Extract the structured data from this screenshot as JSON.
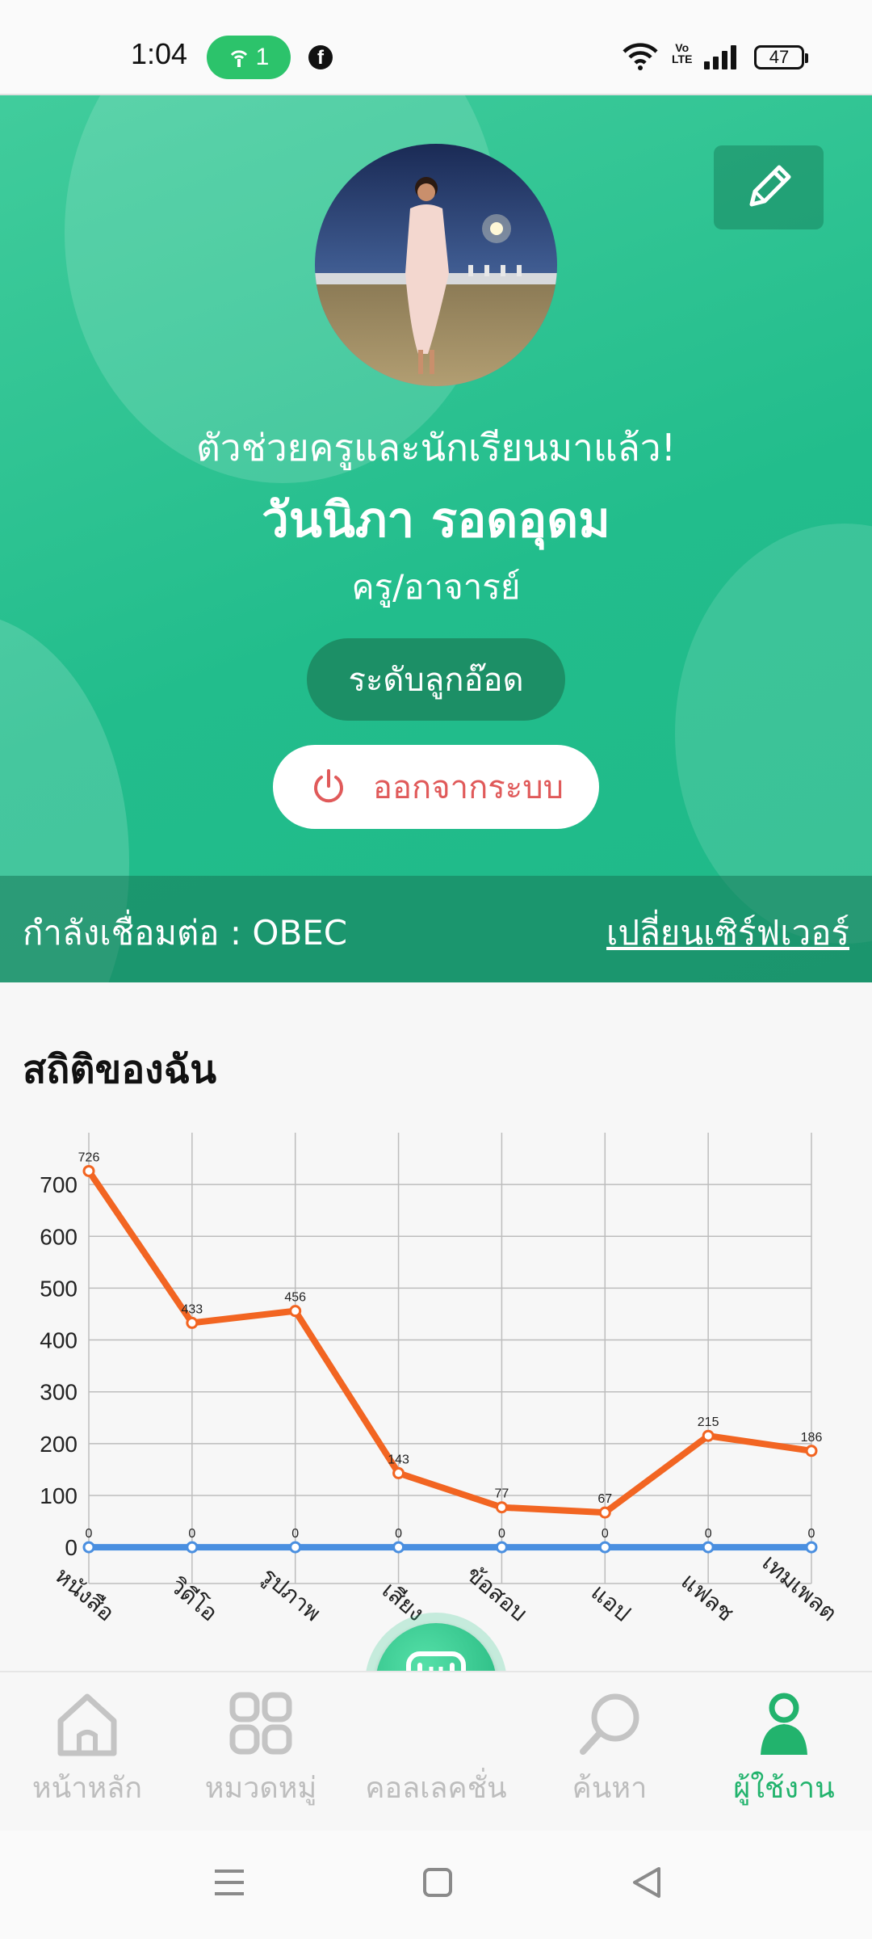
{
  "status_bar": {
    "time": "1:04",
    "hotspot_count": "1",
    "battery": "47",
    "icons": [
      "hotspot-icon",
      "facebook-icon",
      "wifi-icon",
      "volte-icon",
      "signal-icon",
      "battery-icon"
    ]
  },
  "profile": {
    "greeting": "ตัวช่วยครูและนักเรียนมาแล้ว!",
    "name": "วันนิภา รอดอุดม",
    "role": "ครู/อาจารย์",
    "level_button": "ระดับลูกอ๊อด",
    "logout_button": "ออกจากระบบ",
    "edit_icon": "pencil-icon"
  },
  "server": {
    "label": "กำลังเชื่อมต่อ : OBEC",
    "change_link": "เปลี่ยนเซิร์ฟเวอร์"
  },
  "stats": {
    "title": "สถิติของฉัน"
  },
  "chart_data": {
    "type": "line",
    "categories": [
      "หนังสือ",
      "วิดีโอ",
      "รูปภาพ",
      "เสียง",
      "ข้อสอบ",
      "แอป",
      "แฟลช",
      "เทมเพลต"
    ],
    "series": [
      {
        "color": "#f26522",
        "values": [
          726,
          433,
          456,
          143,
          77,
          67,
          215,
          186
        ]
      },
      {
        "color": "#4a8fe0",
        "values": [
          0,
          0,
          0,
          0,
          0,
          0,
          0,
          0
        ]
      }
    ],
    "ylim": [
      -70,
      800
    ],
    "yticks": [
      0,
      100,
      200,
      300,
      400,
      500,
      600,
      700
    ],
    "grid": true
  },
  "bottom_nav": {
    "items": [
      {
        "label": "หน้าหลัก",
        "icon": "home-icon"
      },
      {
        "label": "หมวดหมู่",
        "icon": "category-icon"
      },
      {
        "label": "คอลเลคชั่น",
        "icon": "collection-icon"
      },
      {
        "label": "ค้นหา",
        "icon": "search-icon"
      },
      {
        "label": "ผู้ใช้งาน",
        "icon": "user-icon"
      }
    ],
    "active_index": 4,
    "active_color": "#22b36d"
  },
  "system_nav": [
    "menu-icon",
    "home-square-icon",
    "back-icon"
  ]
}
